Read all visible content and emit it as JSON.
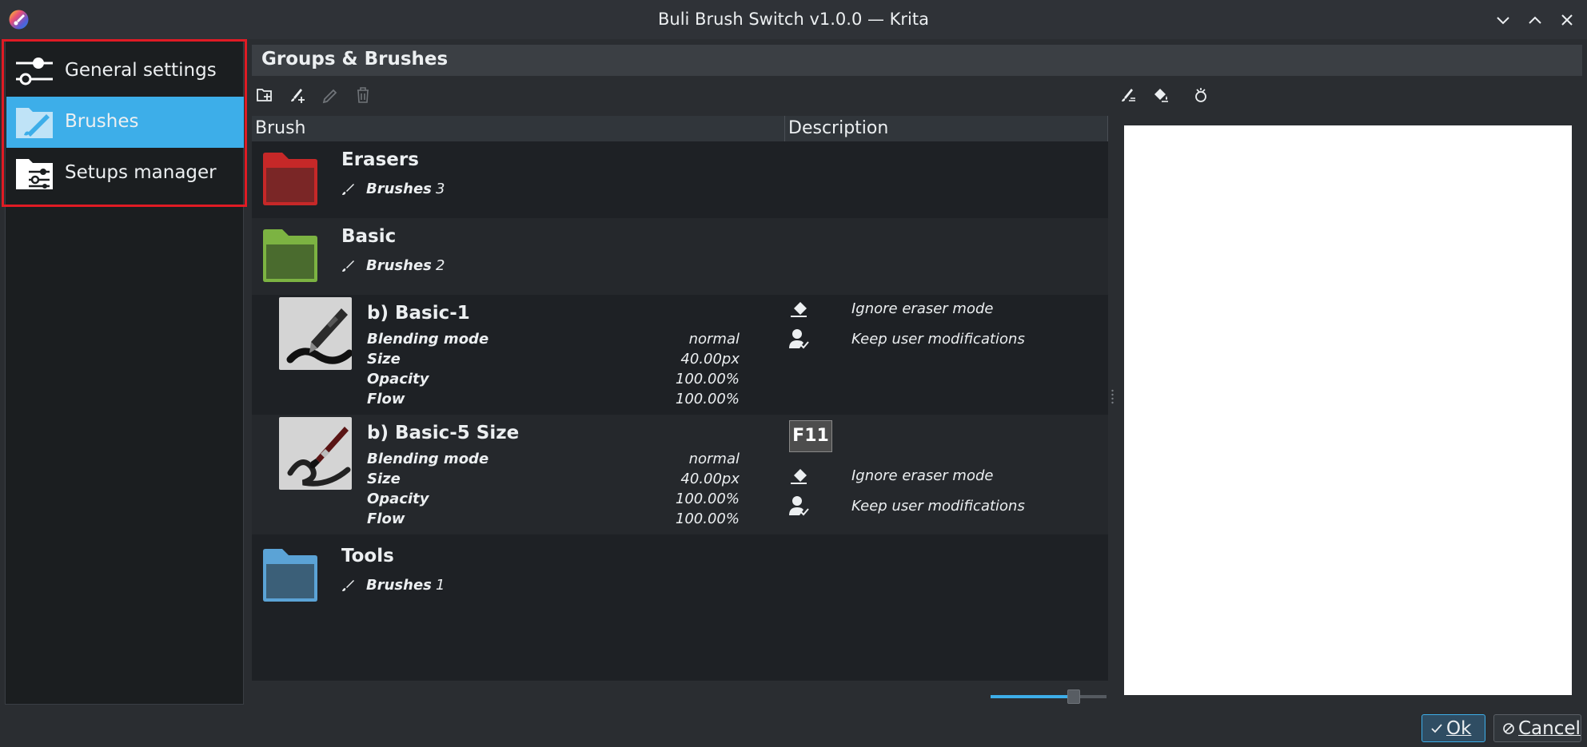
{
  "window": {
    "title": "Buli Brush Switch v1.0.0 — Krita",
    "controls": [
      "minimize",
      "maximize",
      "close"
    ]
  },
  "sidebar": {
    "items": [
      {
        "label": "General settings",
        "icon": "sliders-icon",
        "active": false
      },
      {
        "label": "Brushes",
        "icon": "brush-folder-icon",
        "active": true
      },
      {
        "label": "Setups manager",
        "icon": "setup-folder-icon",
        "active": false
      }
    ]
  },
  "header": {
    "title": "Groups & Brushes"
  },
  "toolbar": {
    "left": [
      "add-group-icon",
      "add-brush-icon",
      "edit-icon",
      "delete-icon"
    ],
    "right": [
      "brush-settings-icon",
      "fill-icon",
      "clean-icon"
    ]
  },
  "tree": {
    "columns": [
      "Brush",
      "Description"
    ],
    "brushes_label": "Brushes",
    "groups": [
      {
        "name": "Erasers",
        "count": "3",
        "color": "#c62828"
      },
      {
        "name": "Basic",
        "count": "2",
        "color": "#7cb342"
      },
      {
        "name": "Tools",
        "count": "1",
        "color": "#5ba3d6"
      }
    ],
    "brushes": [
      {
        "name": "b) Basic-1",
        "props": [
          {
            "label": "Blending mode",
            "value": "normal"
          },
          {
            "label": "Size",
            "value": "40.00px"
          },
          {
            "label": "Opacity",
            "value": "100.00%"
          },
          {
            "label": "Flow",
            "value": "100.00%"
          }
        ],
        "shortcut": "",
        "desc": [
          "Ignore eraser mode",
          "Keep user modifications"
        ]
      },
      {
        "name": "b) Basic-5 Size",
        "props": [
          {
            "label": "Blending mode",
            "value": "normal"
          },
          {
            "label": "Size",
            "value": "40.00px"
          },
          {
            "label": "Opacity",
            "value": "100.00%"
          },
          {
            "label": "Flow",
            "value": "100.00%"
          }
        ],
        "shortcut": "F11",
        "desc": [
          "Ignore eraser mode",
          "Keep user modifications"
        ]
      }
    ]
  },
  "zoom_slider": {
    "level": 0.72
  },
  "colors": {
    "accent": "#3daee9",
    "highlight_frame": "#e01b24",
    "background": "#2a2d31"
  },
  "buttons": {
    "ok": "Ok",
    "cancel": "Cancel"
  }
}
